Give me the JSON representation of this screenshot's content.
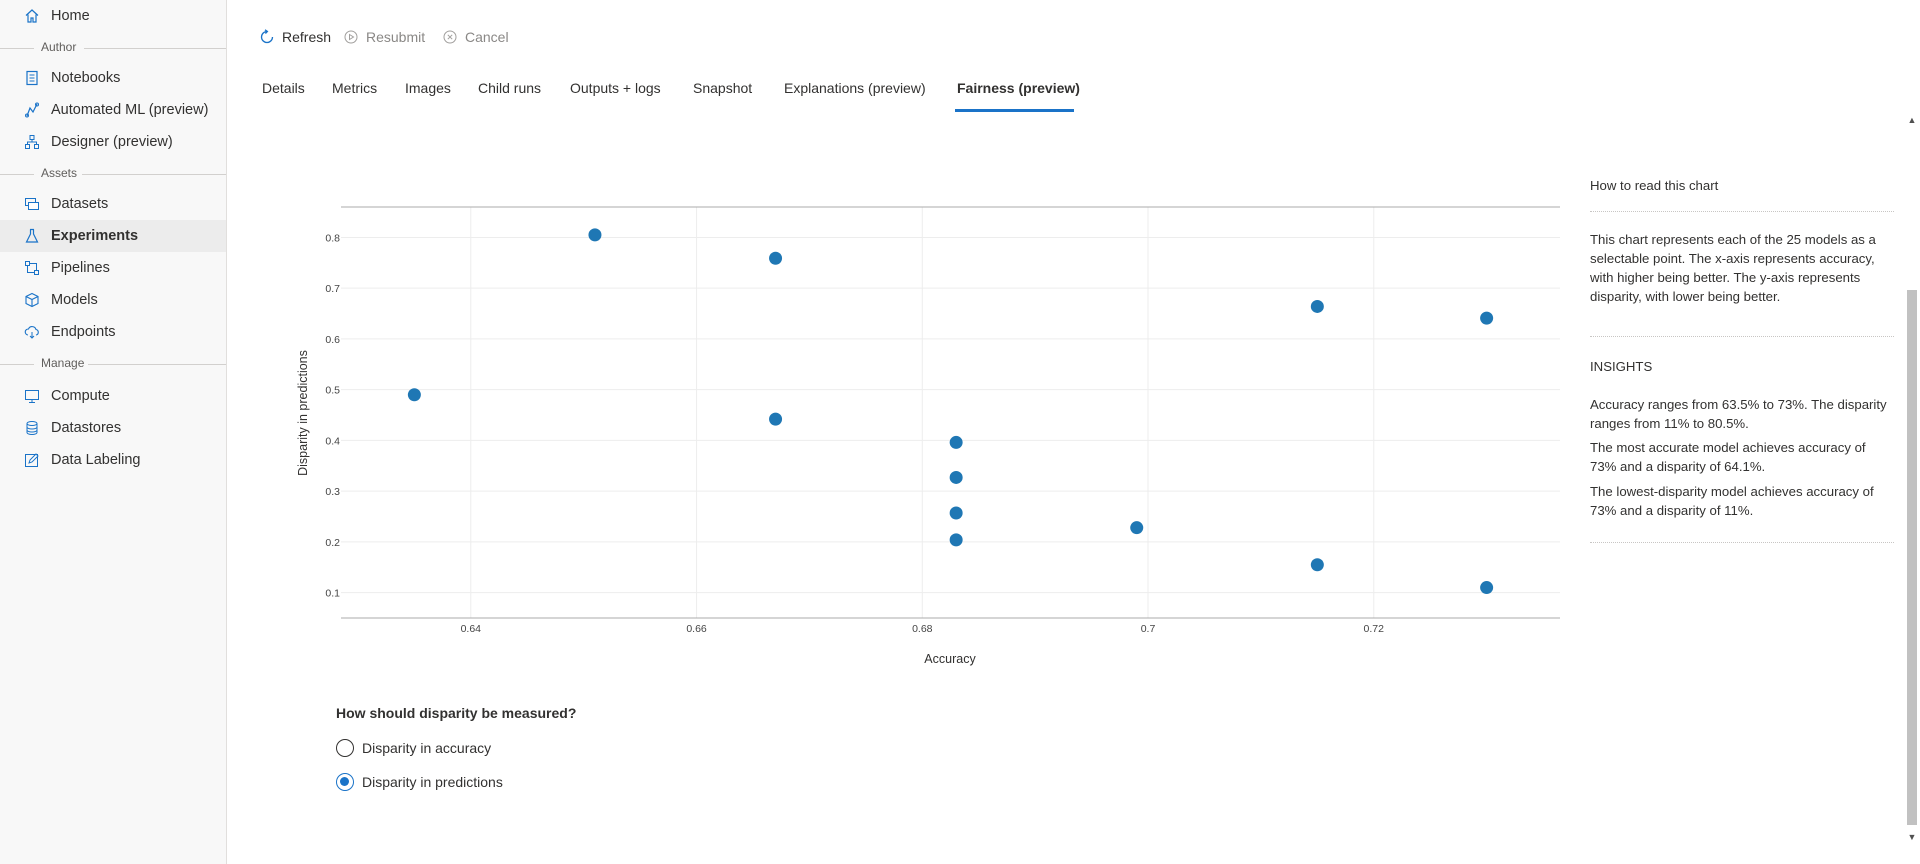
{
  "sidebar": {
    "items": [
      {
        "label": "Home",
        "icon": "home-icon"
      },
      {
        "label": "Notebooks",
        "icon": "notebook-icon"
      },
      {
        "label": "Automated ML (preview)",
        "icon": "automl-icon"
      },
      {
        "label": "Designer (preview)",
        "icon": "designer-icon"
      },
      {
        "label": "Datasets",
        "icon": "datasets-icon"
      },
      {
        "label": "Experiments",
        "icon": "flask-icon"
      },
      {
        "label": "Pipelines",
        "icon": "pipelines-icon"
      },
      {
        "label": "Models",
        "icon": "cube-icon"
      },
      {
        "label": "Endpoints",
        "icon": "endpoints-icon"
      },
      {
        "label": "Compute",
        "icon": "monitor-icon"
      },
      {
        "label": "Datastores",
        "icon": "database-icon"
      },
      {
        "label": "Data Labeling",
        "icon": "edit-icon"
      }
    ],
    "sections": {
      "author": "Author",
      "assets": "Assets",
      "manage": "Manage"
    },
    "active": "Experiments"
  },
  "toolbar": {
    "refresh": "Refresh",
    "resubmit": "Resubmit",
    "cancel": "Cancel"
  },
  "tabs": [
    {
      "label": "Details"
    },
    {
      "label": "Metrics"
    },
    {
      "label": "Images"
    },
    {
      "label": "Child runs"
    },
    {
      "label": "Outputs + logs"
    },
    {
      "label": "Snapshot"
    },
    {
      "label": "Explanations (preview)"
    },
    {
      "label": "Fairness (preview)"
    }
  ],
  "active_tab": "Fairness (preview)",
  "chart_data": {
    "type": "scatter",
    "xlabel": "Accuracy",
    "ylabel": "Disparity in predictions",
    "xlim": [
      0.6285,
      0.7365
    ],
    "ylim": [
      0.05,
      0.86
    ],
    "x_ticks": [
      "0.64",
      "0.66",
      "0.68",
      "0.7",
      "0.72"
    ],
    "y_ticks": [
      "0.1",
      "0.2",
      "0.3",
      "0.4",
      "0.5",
      "0.6",
      "0.7",
      "0.8"
    ],
    "grid": true,
    "color": "#1f77b4",
    "points": [
      {
        "x": 0.635,
        "y": 0.49
      },
      {
        "x": 0.651,
        "y": 0.805
      },
      {
        "x": 0.667,
        "y": 0.759
      },
      {
        "x": 0.667,
        "y": 0.442
      },
      {
        "x": 0.683,
        "y": 0.396
      },
      {
        "x": 0.683,
        "y": 0.327
      },
      {
        "x": 0.683,
        "y": 0.257
      },
      {
        "x": 0.683,
        "y": 0.204
      },
      {
        "x": 0.699,
        "y": 0.228
      },
      {
        "x": 0.715,
        "y": 0.664
      },
      {
        "x": 0.715,
        "y": 0.155
      },
      {
        "x": 0.73,
        "y": 0.641
      },
      {
        "x": 0.73,
        "y": 0.11
      }
    ]
  },
  "info_panel": {
    "how_to_title": "How to read this chart",
    "how_to_text": "This chart represents each of the 25 models as a selectable point. The x-axis represents accuracy, with higher being better. The y-axis represents disparity, with lower being better.",
    "insights_title": "INSIGHTS",
    "insights": [
      "Accuracy ranges from 63.5% to 73%. The disparity ranges from 11% to 80.5%.",
      "The most accurate model achieves accuracy of 73% and a disparity of 64.1%.",
      "The lowest-disparity model achieves accuracy of 73% and a disparity of 11%."
    ]
  },
  "disparity_measure": {
    "question": "How should disparity be measured?",
    "options": [
      {
        "label": "Disparity in accuracy",
        "selected": false
      },
      {
        "label": "Disparity in predictions",
        "selected": true
      }
    ]
  },
  "colors": {
    "accent": "#1a73c8",
    "point": "#1f77b4"
  }
}
